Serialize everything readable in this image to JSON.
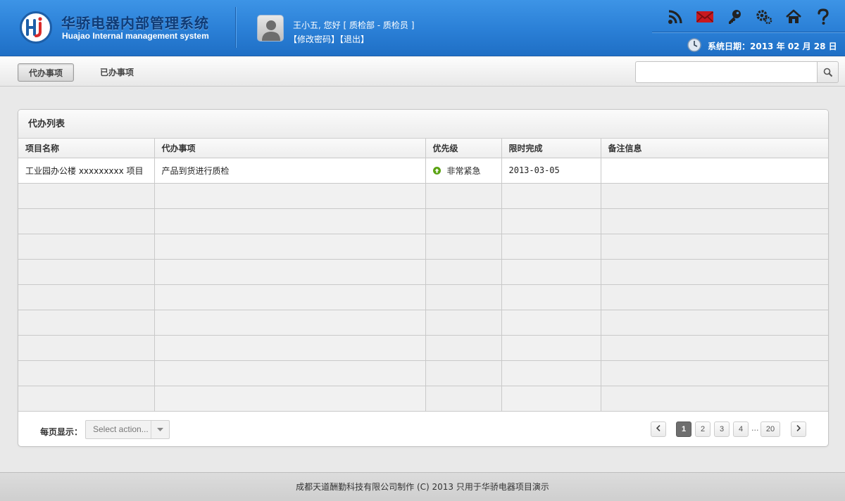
{
  "header": {
    "brand_cn": "华骄电器内部管理系统",
    "brand_en": "Huajao Internal management system",
    "user_greeting": "王小五, 您好 [ 质检部 - 质检员 ]",
    "change_password": "【修改密码】",
    "logout": "【退出】",
    "icons": [
      "rss-icon",
      "mail-icon",
      "key-icon",
      "settings-icon",
      "home-icon",
      "help-icon"
    ],
    "system_date": "系统日期：2013 年 02 月 28 日"
  },
  "toolbar": {
    "tab_pending": "代办事项",
    "tab_done": "已办事项",
    "search_placeholder": ""
  },
  "panel": {
    "title": "代办列表",
    "columns": [
      "项目名称",
      "代办事项",
      "优先级",
      "限时完成",
      "备注信息"
    ],
    "rows": [
      {
        "project": "工业园办公楼 xxxxxxxxx 项目",
        "task": "产品到货进行质检",
        "priority": "非常紧急",
        "deadline": "2013-03-05",
        "remark": ""
      }
    ]
  },
  "pagination": {
    "per_page_label": "每页显示：",
    "select_placeholder": "Select action...",
    "pages": [
      "1",
      "2",
      "3",
      "4",
      "20"
    ],
    "current": "1",
    "ellipsis": "..."
  },
  "footer": {
    "text": "成都天道酬勤科技有限公司制作 (C) 2013 只用于华骄电器项目演示"
  },
  "colors": {
    "header_blue": "#2a7fd6",
    "brand_dark_blue": "#0f3c78",
    "priority_green": "#5ba313",
    "page_active": "#6e6e6e"
  }
}
